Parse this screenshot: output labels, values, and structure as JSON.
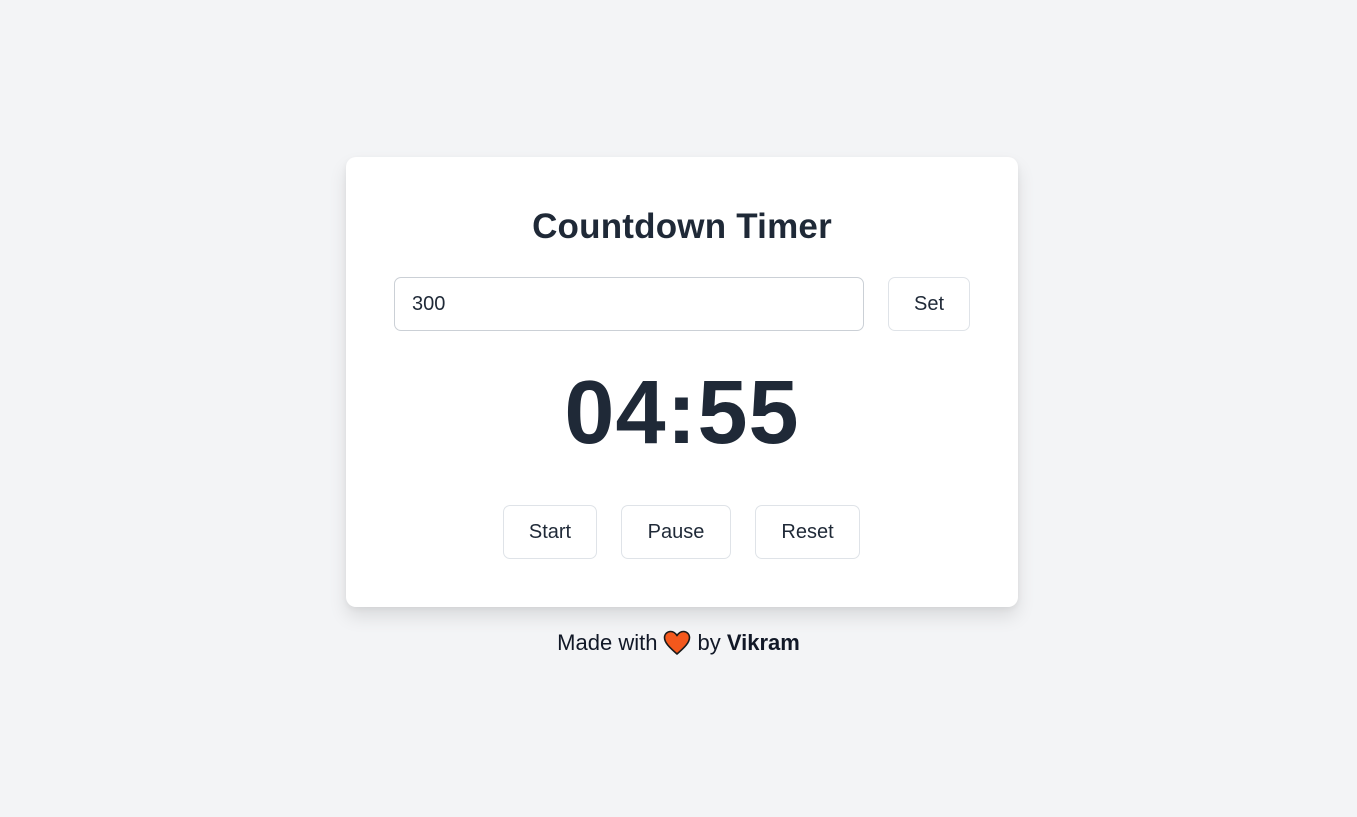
{
  "app": {
    "title": "Countdown Timer"
  },
  "input": {
    "value": "300",
    "set_label": "Set"
  },
  "timer": {
    "display": "04:55"
  },
  "controls": {
    "start_label": "Start",
    "pause_label": "Pause",
    "reset_label": "Reset"
  },
  "footer": {
    "made_with": "Made with",
    "by": "by",
    "author": "Vikram",
    "heart_icon": "heart-icon",
    "heart_color": "#f4581c"
  },
  "colors": {
    "background": "#f3f4f6",
    "card": "#ffffff",
    "text": "#1f2937"
  }
}
